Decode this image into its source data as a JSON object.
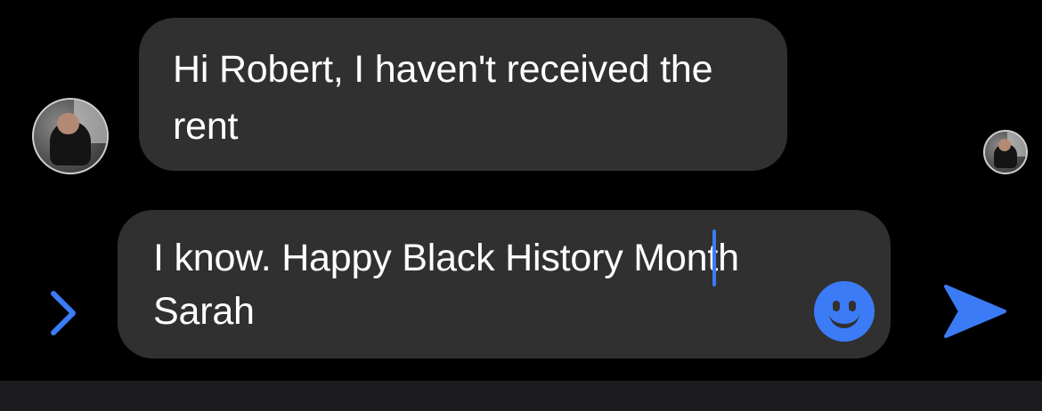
{
  "conversation": {
    "received_message": {
      "text": "Hi Robert, I haven't received the rent"
    }
  },
  "composer": {
    "draft_text": "I know. Happy Black History Month Sarah",
    "emoji_icon": "smiley-face-icon",
    "send_icon": "send-arrow-icon",
    "expand_icon": "chevron-right-icon"
  },
  "colors": {
    "background": "#000000",
    "bubble": "#303030",
    "text": "#ffffff",
    "accent": "#3b7bf6"
  }
}
